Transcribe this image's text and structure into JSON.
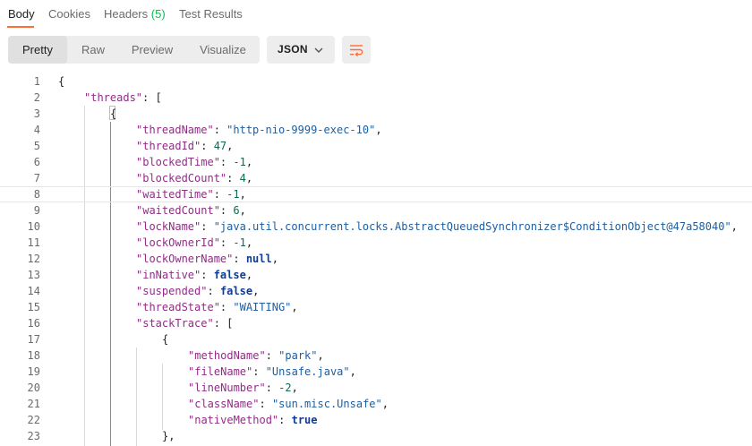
{
  "tabs": [
    {
      "label": "Body",
      "count": ""
    },
    {
      "label": "Cookies",
      "count": ""
    },
    {
      "label": "Headers",
      "count": "(5)"
    },
    {
      "label": "Test Results",
      "count": ""
    }
  ],
  "view_modes": [
    "Pretty",
    "Raw",
    "Preview",
    "Visualize"
  ],
  "active_view_mode": "Pretty",
  "format": {
    "selected": "JSON"
  },
  "colors": {
    "accent": "#ff6c37",
    "count_green": "#0cbb52"
  },
  "current_line": 8,
  "code_lines": [
    {
      "n": "1",
      "indent": 0,
      "tokens": [
        [
          "p",
          "{"
        ]
      ]
    },
    {
      "n": "2",
      "indent": 1,
      "tokens": [
        [
          "k",
          "\"threads\""
        ],
        [
          "p",
          ": ["
        ]
      ]
    },
    {
      "n": "3",
      "indent": 2,
      "tokens": [
        [
          "p",
          "{"
        ]
      ]
    },
    {
      "n": "4",
      "indent": 3,
      "tokens": [
        [
          "k",
          "\"threadName\""
        ],
        [
          "p",
          ": "
        ],
        [
          "s",
          "\"http-nio-9999-exec-10\""
        ],
        [
          "p",
          ","
        ]
      ]
    },
    {
      "n": "5",
      "indent": 3,
      "tokens": [
        [
          "k",
          "\"threadId\""
        ],
        [
          "p",
          ": "
        ],
        [
          "n",
          "47"
        ],
        [
          "p",
          ","
        ]
      ]
    },
    {
      "n": "6",
      "indent": 3,
      "tokens": [
        [
          "k",
          "\"blockedTime\""
        ],
        [
          "p",
          ": "
        ],
        [
          "n",
          "-1"
        ],
        [
          "p",
          ","
        ]
      ]
    },
    {
      "n": "7",
      "indent": 3,
      "tokens": [
        [
          "k",
          "\"blockedCount\""
        ],
        [
          "p",
          ": "
        ],
        [
          "n",
          "4"
        ],
        [
          "p",
          ","
        ]
      ]
    },
    {
      "n": "8",
      "indent": 3,
      "tokens": [
        [
          "k",
          "\"waitedTime\""
        ],
        [
          "p",
          ": "
        ],
        [
          "n",
          "-1"
        ],
        [
          "p",
          ","
        ]
      ]
    },
    {
      "n": "9",
      "indent": 3,
      "tokens": [
        [
          "k",
          "\"waitedCount\""
        ],
        [
          "p",
          ": "
        ],
        [
          "n",
          "6"
        ],
        [
          "p",
          ","
        ]
      ]
    },
    {
      "n": "10",
      "indent": 3,
      "tokens": [
        [
          "k",
          "\"lockName\""
        ],
        [
          "p",
          ": "
        ],
        [
          "s",
          "\"java.util.concurrent.locks.AbstractQueuedSynchronizer$ConditionObject@47a58040\""
        ],
        [
          "p",
          ","
        ]
      ]
    },
    {
      "n": "11",
      "indent": 3,
      "tokens": [
        [
          "k",
          "\"lockOwnerId\""
        ],
        [
          "p",
          ": "
        ],
        [
          "n",
          "-1"
        ],
        [
          "p",
          ","
        ]
      ]
    },
    {
      "n": "12",
      "indent": 3,
      "tokens": [
        [
          "k",
          "\"lockOwnerName\""
        ],
        [
          "p",
          ": "
        ],
        [
          "kw",
          "null"
        ],
        [
          "p",
          ","
        ]
      ]
    },
    {
      "n": "13",
      "indent": 3,
      "tokens": [
        [
          "k",
          "\"inNative\""
        ],
        [
          "p",
          ": "
        ],
        [
          "kw",
          "false"
        ],
        [
          "p",
          ","
        ]
      ]
    },
    {
      "n": "14",
      "indent": 3,
      "tokens": [
        [
          "k",
          "\"suspended\""
        ],
        [
          "p",
          ": "
        ],
        [
          "kw",
          "false"
        ],
        [
          "p",
          ","
        ]
      ]
    },
    {
      "n": "15",
      "indent": 3,
      "tokens": [
        [
          "k",
          "\"threadState\""
        ],
        [
          "p",
          ": "
        ],
        [
          "s",
          "\"WAITING\""
        ],
        [
          "p",
          ","
        ]
      ]
    },
    {
      "n": "16",
      "indent": 3,
      "tokens": [
        [
          "k",
          "\"stackTrace\""
        ],
        [
          "p",
          ": ["
        ]
      ]
    },
    {
      "n": "17",
      "indent": 4,
      "tokens": [
        [
          "p",
          "{"
        ]
      ]
    },
    {
      "n": "18",
      "indent": 5,
      "tokens": [
        [
          "k",
          "\"methodName\""
        ],
        [
          "p",
          ": "
        ],
        [
          "s",
          "\"park\""
        ],
        [
          "p",
          ","
        ]
      ]
    },
    {
      "n": "19",
      "indent": 5,
      "tokens": [
        [
          "k",
          "\"fileName\""
        ],
        [
          "p",
          ": "
        ],
        [
          "s",
          "\"Unsafe.java\""
        ],
        [
          "p",
          ","
        ]
      ]
    },
    {
      "n": "20",
      "indent": 5,
      "tokens": [
        [
          "k",
          "\"lineNumber\""
        ],
        [
          "p",
          ": "
        ],
        [
          "n",
          "-2"
        ],
        [
          "p",
          ","
        ]
      ]
    },
    {
      "n": "21",
      "indent": 5,
      "tokens": [
        [
          "k",
          "\"className\""
        ],
        [
          "p",
          ": "
        ],
        [
          "s",
          "\"sun.misc.Unsafe\""
        ],
        [
          "p",
          ","
        ]
      ]
    },
    {
      "n": "22",
      "indent": 5,
      "tokens": [
        [
          "k",
          "\"nativeMethod\""
        ],
        [
          "p",
          ": "
        ],
        [
          "kw",
          "true"
        ]
      ]
    },
    {
      "n": "23",
      "indent": 4,
      "tokens": [
        [
          "p",
          "},"
        ]
      ]
    }
  ]
}
